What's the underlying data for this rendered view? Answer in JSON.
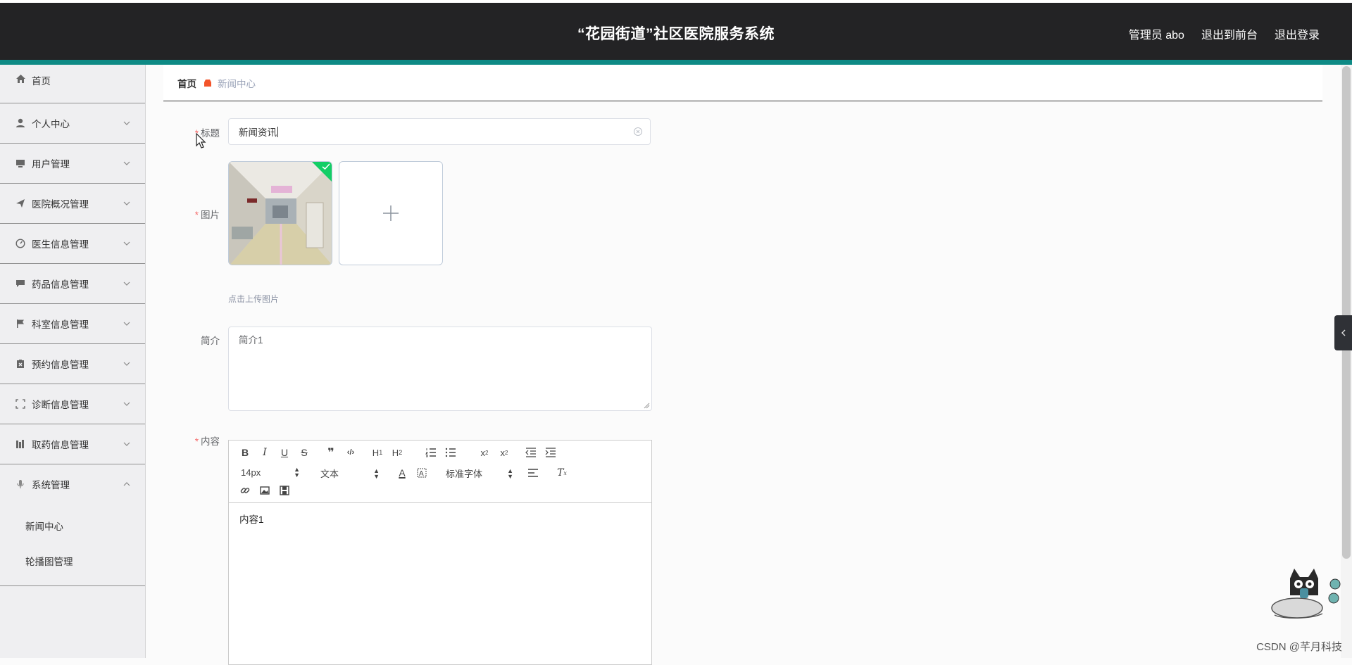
{
  "header": {
    "title": "“花园街道”社区医院服务系统",
    "user_label": "管理员 abo",
    "to_front_label": "退出到前台",
    "logout_label": "退出登录"
  },
  "sidebar": {
    "items": [
      {
        "label": "首页",
        "icon": "home-icon"
      },
      {
        "label": "个人中心",
        "icon": "user-icon"
      },
      {
        "label": "用户管理",
        "icon": "monitor-icon"
      },
      {
        "label": "医院概况管理",
        "icon": "paper-plane-icon"
      },
      {
        "label": "医生信息管理",
        "icon": "gauge-icon"
      },
      {
        "label": "药品信息管理",
        "icon": "message-icon"
      },
      {
        "label": "科室信息管理",
        "icon": "flag-icon"
      },
      {
        "label": "预约信息管理",
        "icon": "clipboard-icon"
      },
      {
        "label": "诊断信息管理",
        "icon": "fullscreen-icon"
      },
      {
        "label": "取药信息管理",
        "icon": "books-icon"
      },
      {
        "label": "系统管理",
        "icon": "microphone-icon"
      }
    ],
    "subitems": [
      {
        "label": "新闻中心"
      },
      {
        "label": "轮播图管理"
      }
    ]
  },
  "breadcrumb": {
    "home": "首页",
    "current": "新闻中心"
  },
  "form": {
    "title_label": "标题",
    "title_value": "新闻资讯",
    "image_label": "图片",
    "upload_tip": "点击上传图片",
    "intro_label": "简介",
    "intro_value": "简介1",
    "content_label": "内容",
    "content_value": "内容1"
  },
  "editor": {
    "font_size": "14px",
    "block_format": "文本",
    "font_family": "标准字体"
  },
  "watermark": "CSDN @芊月科技",
  "colors": {
    "header_bg": "#232325",
    "accent": "#0e8a85",
    "required": "#f56c6c",
    "upload_success": "#13ce66"
  }
}
